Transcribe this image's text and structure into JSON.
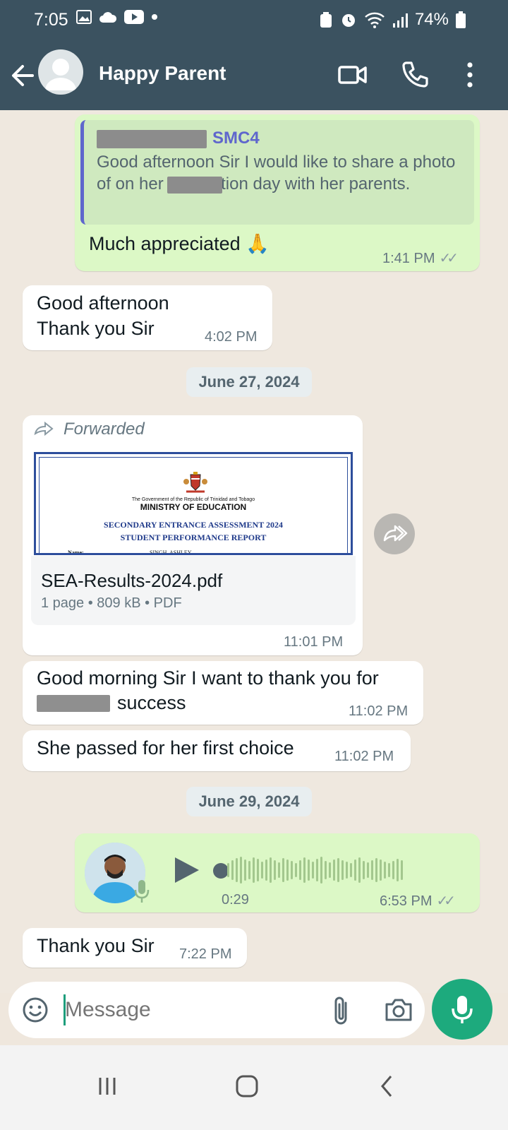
{
  "status_bar": {
    "time": "7:05",
    "battery": "74%"
  },
  "header": {
    "contact_name": "Happy Parent"
  },
  "messages": {
    "quoted_reply": {
      "quote_name": "SMC4",
      "quote_text": "Good afternoon Sir I would like to share a photo of           on her graduation day with her parents.",
      "text": "Much appreciated 🙏",
      "time": "1:41 PM"
    },
    "msg_good_afternoon": {
      "line1": "Good afternoon",
      "line2": "Thank you Sir",
      "time": "4:02 PM"
    },
    "date_1": "June 27, 2024",
    "forwarded_doc": {
      "forwarded_label": "Forwarded",
      "preview": {
        "gov_line": "The Government of the Republic of Trinidad and Tobago",
        "ministry": "MINISTRY OF EDUCATION",
        "title1": "SECONDARY ENTRANCE ASSESSMENT 2024",
        "title2": "STUDENT PERFORMANCE REPORT",
        "name_label": "Name:",
        "name_value": "SINGH, ASHLEY"
      },
      "file_name": "SEA-Results-2024.pdf",
      "file_info": "1 page • 809 kB • PDF",
      "time": "11:01 PM"
    },
    "msg_good_morning": {
      "line1": "Good morning Sir I want to thank you for",
      "line2": "success",
      "time": "11:02 PM"
    },
    "msg_passed": {
      "text": "She passed for her first choice",
      "time": "11:02 PM"
    },
    "date_2": "June 29, 2024",
    "voice_note": {
      "duration": "0:29",
      "time": "6:53 PM"
    },
    "msg_thank_you": {
      "text": "Thank you Sir",
      "time": "7:22 PM"
    }
  },
  "composer": {
    "placeholder": "Message"
  },
  "colors": {
    "header": "#3b5260",
    "outgoing": "#dcf8c6",
    "incoming": "#ffffff",
    "accent": "#1daa7d",
    "quote_bar": "#5f66cd"
  }
}
